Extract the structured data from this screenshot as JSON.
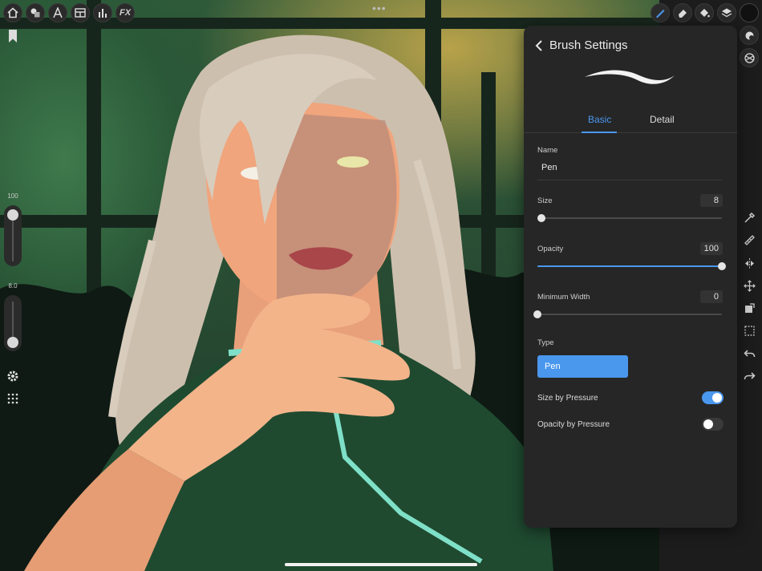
{
  "top_toolbar": {
    "left_tools": [
      {
        "icon": "home-icon"
      },
      {
        "icon": "shapes-icon"
      },
      {
        "icon": "text-tool-icon"
      },
      {
        "icon": "layout-icon"
      },
      {
        "icon": "tools-icon"
      },
      {
        "icon": "fx-icon",
        "label": "FX"
      }
    ],
    "more_dots": "•••",
    "right_tools": [
      {
        "icon": "brush-icon",
        "active": true
      },
      {
        "icon": "eraser-icon"
      },
      {
        "icon": "fill-bucket-icon"
      },
      {
        "icon": "layers-icon"
      }
    ],
    "current_color": "#111111"
  },
  "left_sidebar": {
    "size_slider": {
      "value_label": "100",
      "level": 1.0
    },
    "opacity_slider": {
      "value_label": "8.0",
      "level": 0.0
    }
  },
  "right_column": {
    "icons": [
      "shape-icon",
      "texture-icon",
      "eyedropper-icon",
      "ruler-icon",
      "symmetry-icon",
      "move-icon",
      "transform-icon",
      "selection-icon",
      "undo-icon",
      "redo-icon"
    ]
  },
  "brush_panel": {
    "title": "Brush Settings",
    "tabs": [
      {
        "label": "Basic",
        "active": true
      },
      {
        "label": "Detail",
        "active": false
      }
    ],
    "name_label": "Name",
    "name_value": "Pen",
    "size": {
      "label": "Size",
      "value": "8",
      "level": 0.02
    },
    "opacity": {
      "label": "Opacity",
      "value": "100",
      "level": 1.0
    },
    "min_width": {
      "label": "Minimum Width",
      "value": "0",
      "level": 0.0
    },
    "type_label": "Type",
    "type_value": "Pen",
    "toggles": [
      {
        "label": "Size by Pressure",
        "on": true
      },
      {
        "label": "Opacity by Pressure",
        "on": false
      }
    ]
  },
  "colors": {
    "accent": "#4a97ee",
    "panel_bg": "#262626",
    "outfit_trim": "#7fe0c8"
  }
}
